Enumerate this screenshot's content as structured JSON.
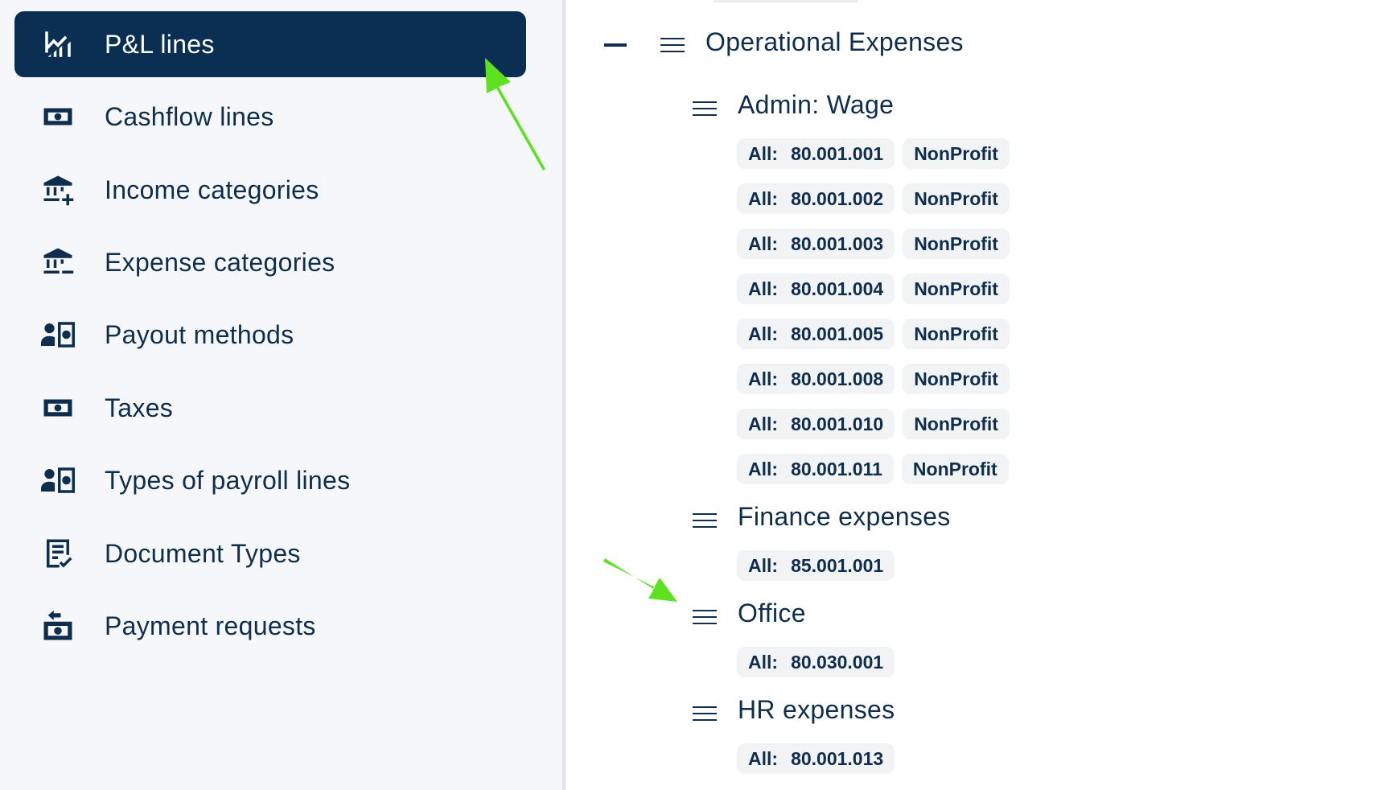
{
  "sidebar": {
    "items": [
      {
        "label": "P&L lines",
        "icon": "chart-trend-icon",
        "active": true
      },
      {
        "label": "Cashflow lines",
        "icon": "cash-icon"
      },
      {
        "label": "Income categories",
        "icon": "bank-plus-icon"
      },
      {
        "label": "Expense categories",
        "icon": "bank-minus-icon"
      },
      {
        "label": "Payout methods",
        "icon": "person-cash-icon"
      },
      {
        "label": "Taxes",
        "icon": "cash-icon"
      },
      {
        "label": "Types of payroll lines",
        "icon": "person-cash-icon"
      },
      {
        "label": "Document Types",
        "icon": "document-check-icon"
      },
      {
        "label": "Payment requests",
        "icon": "cash-request-icon"
      }
    ]
  },
  "main": {
    "group": {
      "title": "Operational Expenses"
    },
    "subgroups": [
      {
        "title": "Admin: Wage",
        "rows": [
          {
            "prefix": "All:",
            "code": "80.001.001",
            "tag": "NonProfit"
          },
          {
            "prefix": "All:",
            "code": "80.001.002",
            "tag": "NonProfit"
          },
          {
            "prefix": "All:",
            "code": "80.001.003",
            "tag": "NonProfit"
          },
          {
            "prefix": "All:",
            "code": "80.001.004",
            "tag": "NonProfit"
          },
          {
            "prefix": "All:",
            "code": "80.001.005",
            "tag": "NonProfit"
          },
          {
            "prefix": "All:",
            "code": "80.001.008",
            "tag": "NonProfit"
          },
          {
            "prefix": "All:",
            "code": "80.001.010",
            "tag": "NonProfit"
          },
          {
            "prefix": "All:",
            "code": "80.001.011",
            "tag": "NonProfit"
          }
        ]
      },
      {
        "title": "Finance expenses",
        "rows": [
          {
            "prefix": "All:",
            "code": "85.001.001"
          }
        ]
      },
      {
        "title": "Office",
        "rows": [
          {
            "prefix": "All:",
            "code": "80.030.001"
          }
        ]
      },
      {
        "title": "HR expenses",
        "rows": [
          {
            "prefix": "All:",
            "code": "80.001.013"
          }
        ]
      }
    ]
  },
  "colors": {
    "active_bg": "#0b2f52",
    "text": "#0f2d4c",
    "chip_bg": "#f2f3f5",
    "arrow": "#5ee11e"
  }
}
